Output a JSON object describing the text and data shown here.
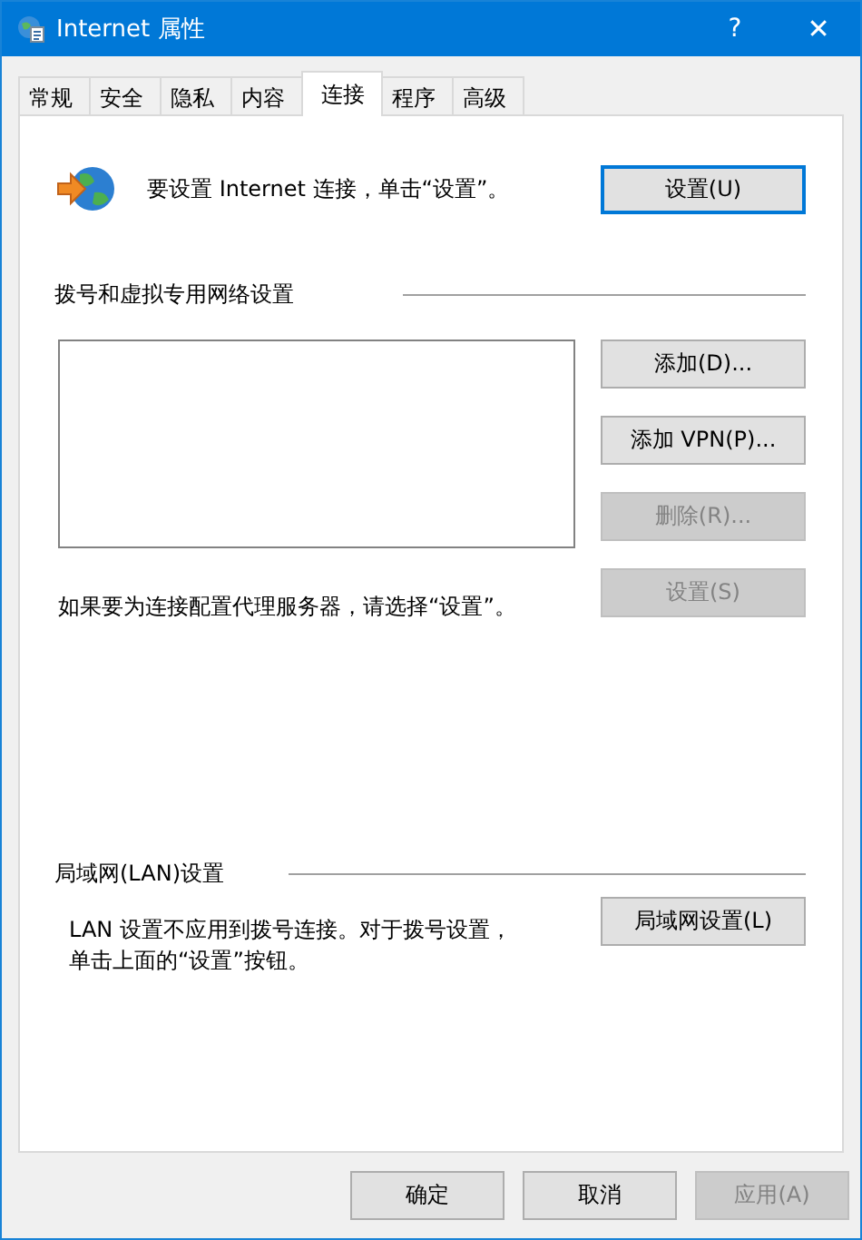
{
  "window": {
    "title": "Internet 属性",
    "help": "?",
    "close": "✕"
  },
  "tabs": [
    {
      "label": "常规",
      "selected": false
    },
    {
      "label": "安全",
      "selected": false
    },
    {
      "label": "隐私",
      "selected": false
    },
    {
      "label": "内容",
      "selected": false
    },
    {
      "label": "连接",
      "selected": true
    },
    {
      "label": "程序",
      "selected": false
    },
    {
      "label": "高级",
      "selected": false
    }
  ],
  "setup": {
    "text": "要设置 Internet 连接，单击“设置”。",
    "button": {
      "label": "设置(U)",
      "disabled": false
    }
  },
  "dialup": {
    "heading": "拨号和虚拟专用网络设置",
    "buttons": [
      {
        "label": "添加(D)...",
        "disabled": false
      },
      {
        "label": "添加 VPN(P)...",
        "disabled": false
      },
      {
        "label": "删除(R)...",
        "disabled": true
      },
      {
        "label": "设置(S)",
        "disabled": true
      }
    ],
    "proxy_text": "如果要为连接配置代理服务器，请选择“设置”。"
  },
  "lan": {
    "heading": "局域网(LAN)设置",
    "text": "LAN 设置不应用到拨号连接。对于拨号设置，单击上面的“设置”按钮。",
    "button": {
      "label": "局域网设置(L)",
      "disabled": false
    }
  },
  "footer_buttons": [
    {
      "label": "确定",
      "disabled": false
    },
    {
      "label": "取消",
      "disabled": false
    },
    {
      "label": "应用(A)",
      "disabled": true
    }
  ]
}
